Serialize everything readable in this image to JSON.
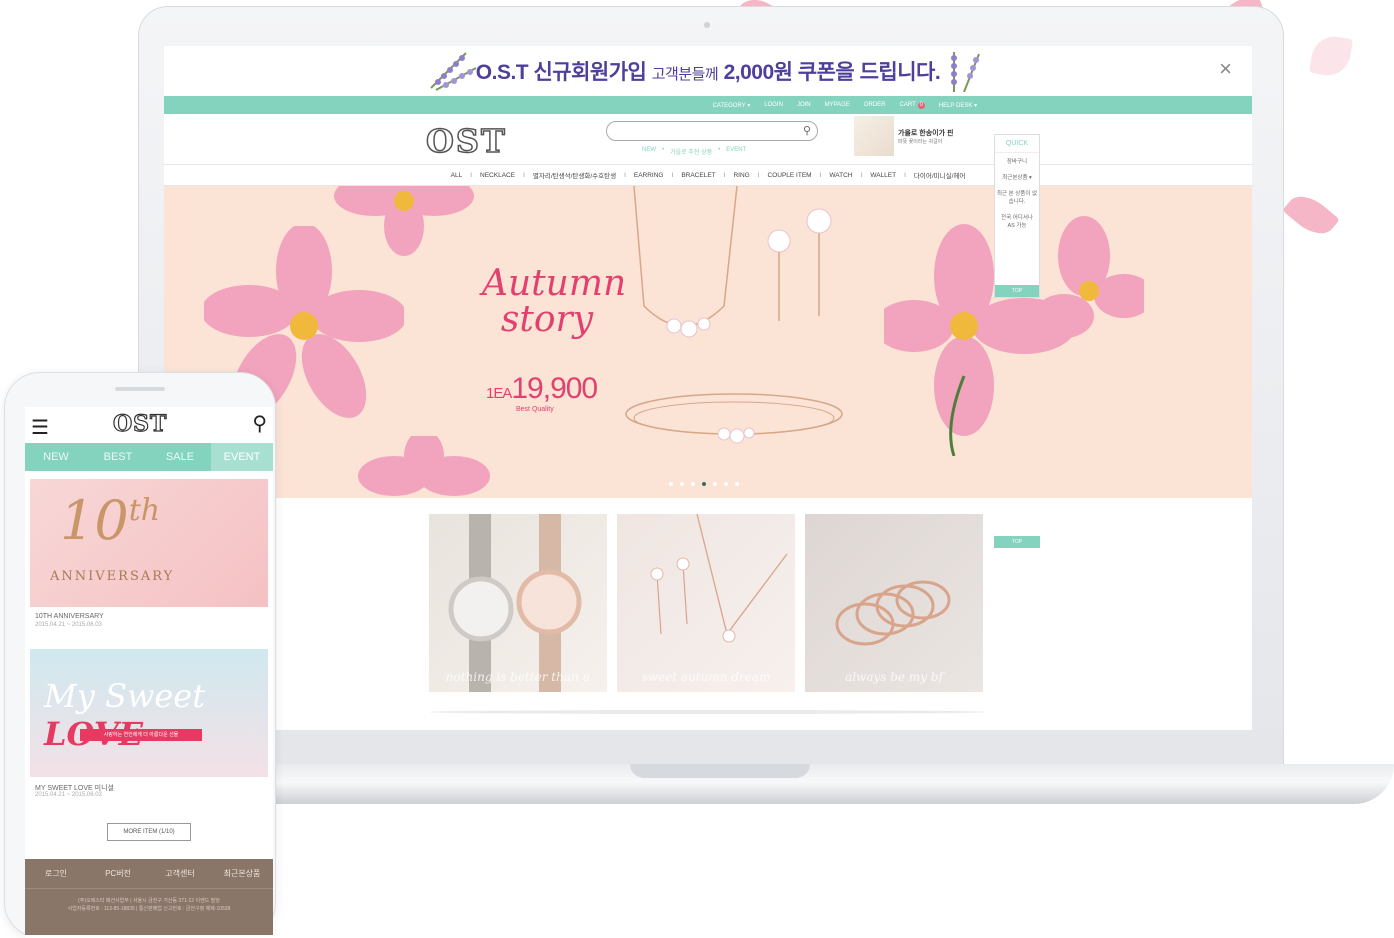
{
  "promo": {
    "brand": "O.S.T 신규회원가입",
    "middle": "고객분들께",
    "amount": "2,000원",
    "tail": "쿠폰을 드립니다.",
    "close": "×"
  },
  "topbar": {
    "category": "CATEGORY ▾",
    "login": "LOGIN",
    "join": "JOIN",
    "mypage": "MYPAGE",
    "order": "ORDER",
    "cart": "CART",
    "cart_count": "0",
    "helpdesk": "HELP DESK ▾"
  },
  "header": {
    "logo": "OST",
    "sublinks": [
      "NEW",
      "•",
      "가을로 추천 상품",
      "•",
      "EVENT"
    ],
    "ad_title": "가을로 한송이가 핀",
    "ad_sub": "따뜻 꽃이라는 귀걸이"
  },
  "catnav": [
    "ALL",
    "NECKLACE",
    "별자리/탄생석/탄생화/수호탄생",
    "EARRING",
    "BRACELET",
    "RING",
    "COUPLE ITEM",
    "WATCH",
    "WALLET",
    "다이어/미니실/헤어"
  ],
  "hero": {
    "title": "Autumn story",
    "price_prefix": "1EA",
    "price": "19,900",
    "sub": "Best Quality"
  },
  "quick": {
    "title": "QUICK",
    "items": [
      "장바구니",
      "최근본상품 ▾",
      "최근 본 상품이 없습니다.",
      "전국 어디서나 AS 가능"
    ],
    "top": "TOP"
  },
  "top2": "TOP",
  "thumbs": [
    {
      "caption": "nothing is better than u"
    },
    {
      "caption": "sweet autumn dream"
    },
    {
      "caption": "always be my bf"
    }
  ],
  "phone": {
    "logo": "OST",
    "tabs": [
      "NEW",
      "BEST",
      "SALE",
      "EVENT"
    ],
    "card1_big": "10",
    "card1_sup": "th",
    "card1_word": "ANNIVERSARY",
    "card1_caption": "10TH ANNIVERSARY",
    "card1_date": "2015.04.21 ~ 2015.06.03",
    "card2_title_a": "My Sweet",
    "card2_title_b": "LOVE",
    "card2_pill": "사랑하는 연인에게 더 아름다운 선물",
    "card2_caption": "MY SWEET LOVE 미니셜",
    "card2_date": "2015.04.21 ~ 2015.06.03",
    "more": "MORE ITEM (1/10)",
    "footer_nav": [
      "로그인",
      "PC버전",
      "고객센터",
      "최근본상품"
    ],
    "footer_line1": "(주)오에스티 패션사업부 | 서울시 금천구 가산동 371-12 이앤드 빌딩",
    "footer_line2": "사업자등록번호 : 113-85-18835 | 통신판매업 신고번호 : 금천구청 제제-10538"
  },
  "colors": {
    "mint": "#84d3bf",
    "pink": "#e2416f",
    "peach": "#fbe3d6",
    "footer": "#8a7569"
  }
}
